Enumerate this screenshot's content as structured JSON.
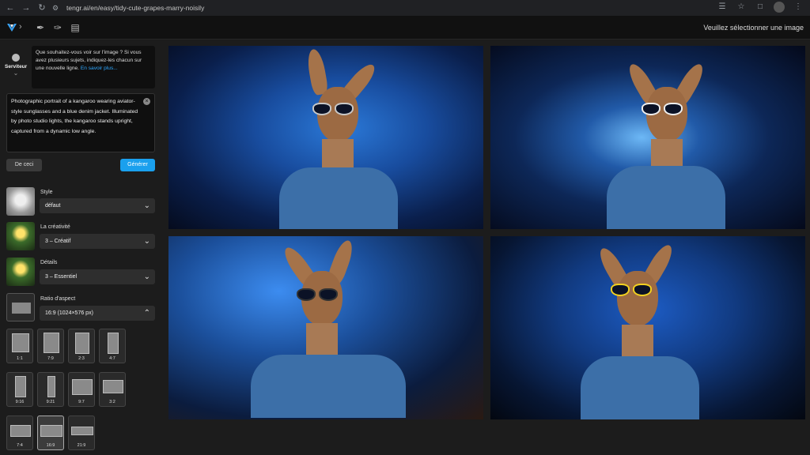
{
  "browser": {
    "url": "tengr.ai/en/easy/tidy-cute-grapes-marry-noisily"
  },
  "header": {
    "status": "Veuillez sélectionner une image"
  },
  "sidebar": {
    "server_label": "Serviteur",
    "hint_text": "Que souhaitez-vous voir sur l'image ? Si vous avez plusieurs sujets, indiquez-les chacun sur une nouvelle ligne.",
    "hint_link": "En savoir plus...",
    "prompt": "Photographic portrait of a kangaroo wearing aviator-style sunglasses and a blue denim jacket. Illuminated by photo studio lights, the kangaroo stands upright, captured from a dynamic low angle.",
    "btn_from": "De ceci",
    "btn_generate": "Générer",
    "style": {
      "label": "Style",
      "value": "défaut"
    },
    "creativity": {
      "label": "La créativité",
      "value": "3 – Créatif"
    },
    "details": {
      "label": "Détails",
      "value": "3 – Essentiel"
    },
    "aspect": {
      "label": "Ratio d'aspect",
      "value": "16:9 (1024×576 px)"
    },
    "ratios": [
      "1:1",
      "7:9",
      "2:3",
      "4:7",
      "9:16",
      "9:21",
      "9:7",
      "3:2",
      "7:4",
      "16:9",
      "21:9"
    ],
    "selected_ratio": "16:9"
  },
  "gallery": {
    "images": [
      "kangaroo-1",
      "kangaroo-2",
      "kangaroo-3",
      "kangaroo-4"
    ]
  },
  "colors": {
    "accent": "#1aa0ee",
    "link": "#2ea7ff"
  }
}
